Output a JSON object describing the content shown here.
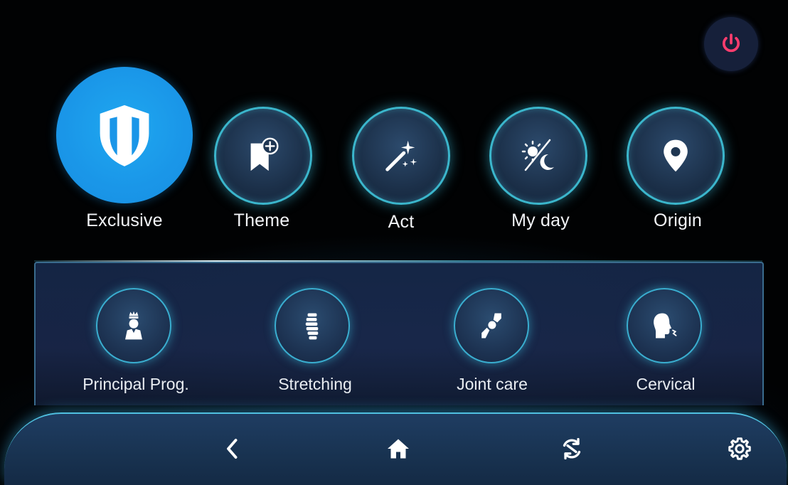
{
  "top_menu": [
    {
      "label": "Exclusive",
      "icon": "shield-icon",
      "selected": true
    },
    {
      "label": "Theme",
      "icon": "bookmark-add-icon"
    },
    {
      "label": "Act",
      "icon": "magic-wand-icon"
    },
    {
      "label": "My day",
      "icon": "day-night-icon"
    },
    {
      "label": "Origin",
      "icon": "location-pin-icon"
    }
  ],
  "programs": [
    {
      "label": "Principal Prog.",
      "icon": "crowned-person-icon"
    },
    {
      "label": "Stretching",
      "icon": "spine-icon"
    },
    {
      "label": "Joint care",
      "icon": "joint-icon"
    },
    {
      "label": "Cervical",
      "icon": "head-neck-icon"
    }
  ],
  "navbar": {
    "back_icon": "chevron-left-icon",
    "home_icon": "home-icon",
    "sync_icon": "sync-icon",
    "settings_icon": "gear-icon"
  },
  "power_icon": "power-icon",
  "colors": {
    "accent_blue": "#1a96e8",
    "ring_cyan": "#3bb6cc",
    "power_red": "#ff3d6e",
    "panel_bg": "#1a2c4c"
  }
}
